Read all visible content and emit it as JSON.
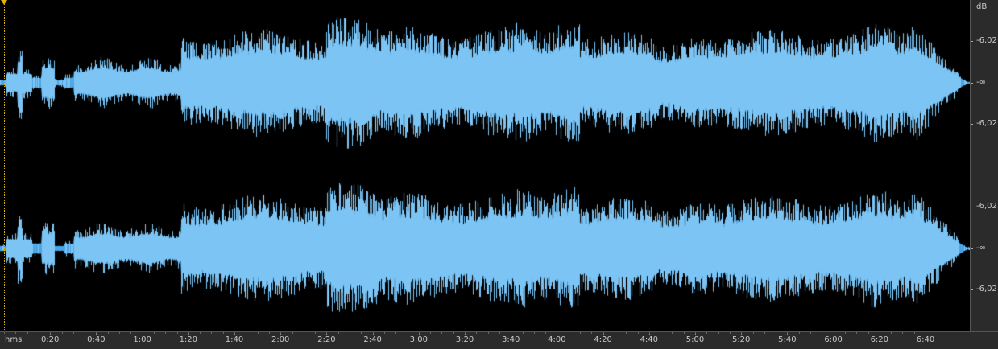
{
  "db_ruler": {
    "unit": "dB",
    "top_labels": [
      "-6,02",
      "-∞",
      "-6,02"
    ],
    "bottom_labels": [
      "-6,02",
      "-∞",
      "-6,02"
    ]
  },
  "time_ruler": {
    "unit": "hms",
    "labels": [
      "0:20",
      "0:40",
      "1:00",
      "1:20",
      "1:40",
      "2:00",
      "2:20",
      "2:40",
      "3:00",
      "3:20",
      "3:40",
      "4:00",
      "4:20",
      "4:40",
      "5:00",
      "5:20",
      "5:40",
      "6:00",
      "6:20",
      "6:40"
    ]
  },
  "channels": [
    "left",
    "right"
  ],
  "colors": {
    "background": "#000000",
    "waveform_light": "#7cc4f4",
    "waveform_dark": "#2e86cc",
    "ruler_bg": "#2b2b2b",
    "ruler_text": "#c8c8c8",
    "playhead": "#e0b400"
  }
}
